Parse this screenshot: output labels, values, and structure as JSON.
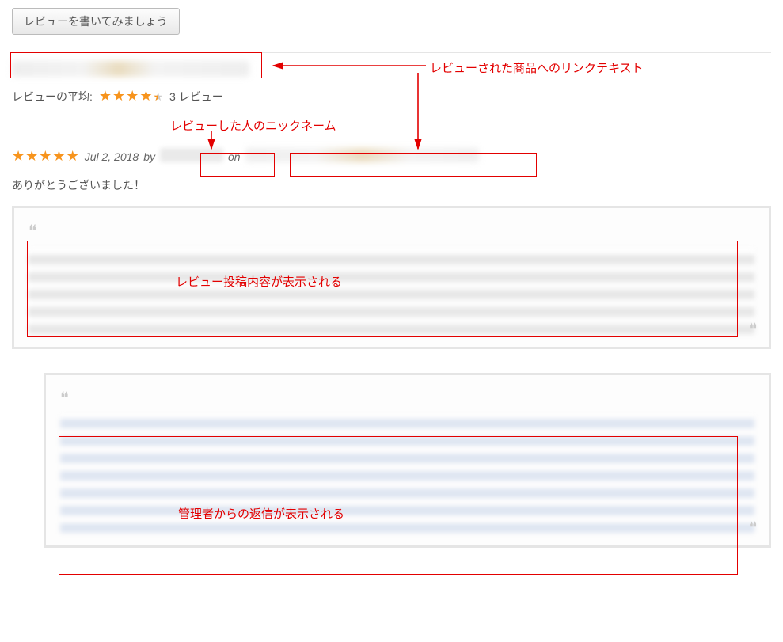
{
  "buttons": {
    "write_review": "レビューを書いてみましょう"
  },
  "average": {
    "label": "レビューの平均:",
    "count_text": "3 レビュー",
    "rating": 4.5
  },
  "review": {
    "rating": 5,
    "date": "Jul 2, 2018",
    "by": "by",
    "on": "on",
    "thanks": "ありがとうございました！"
  },
  "annotations": {
    "product_link": "レビューされた商品へのリンクテキスト",
    "nickname": "レビューした人のニックネーム",
    "review_body": "レビュー投稿内容が表示される",
    "admin_reply": "管理者からの返信が表示される"
  },
  "quote_glyph": "❝"
}
